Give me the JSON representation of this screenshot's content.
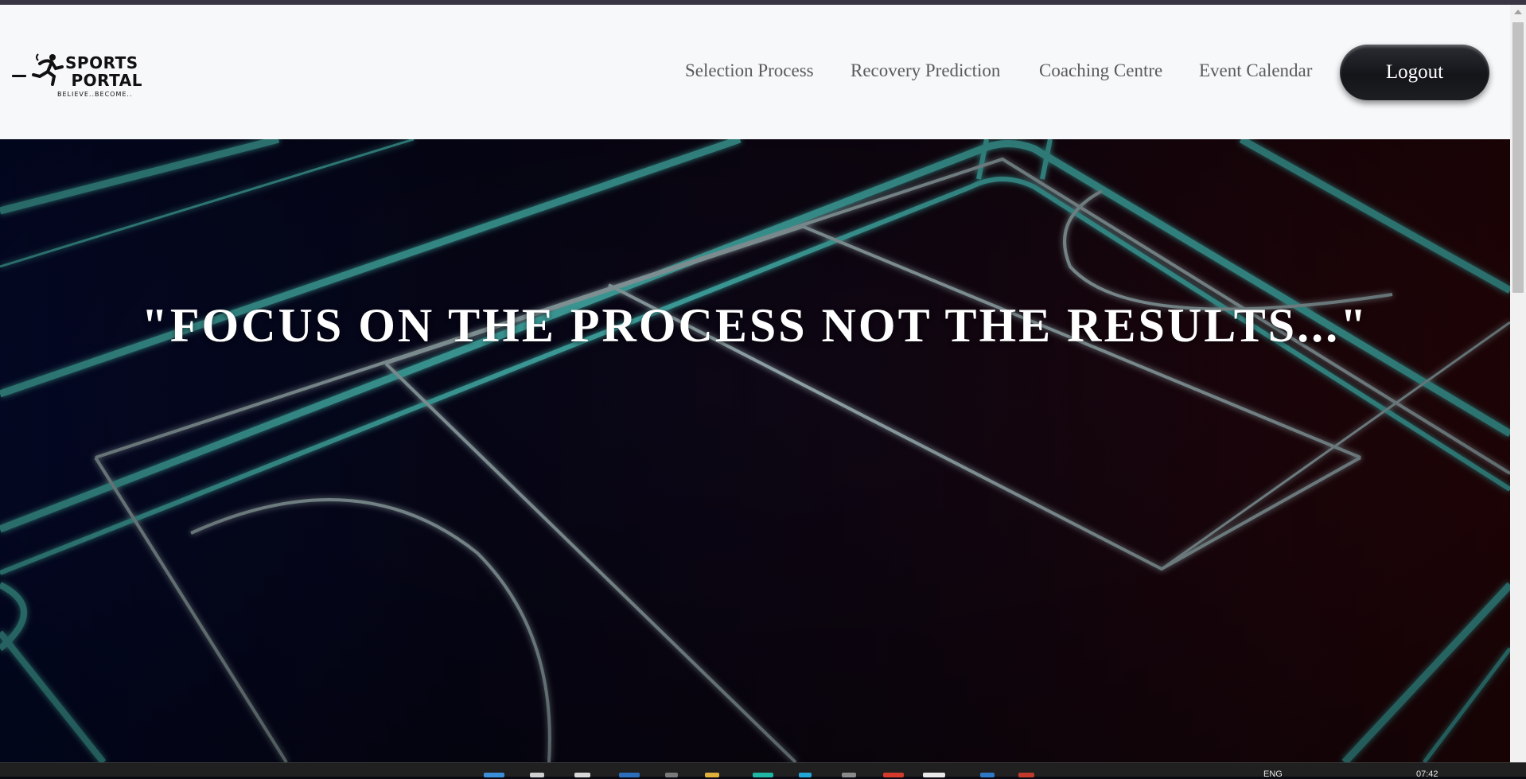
{
  "brand": {
    "title": "SPORTS\n PORTAL",
    "tagline": "BELIEVE..BECOME.."
  },
  "nav": {
    "links": [
      {
        "label": "Selection Process"
      },
      {
        "label": "Recovery Prediction"
      },
      {
        "label": "Coaching Centre"
      },
      {
        "label": "Event Calendar"
      }
    ],
    "logout_label": "Logout"
  },
  "hero": {
    "quote": "\"FOCUS ON THE PROCESS NOT THE RESULTS...\""
  },
  "taskbar": {
    "language": "ENG",
    "clock": "07:42"
  },
  "colors": {
    "court_line": "#3fa7a3",
    "nav_bg": "#f7f8fa",
    "logout_bg": "#16171b"
  },
  "icons": [
    "menu-toggle-icon",
    "runner-logo-icon",
    "scroll-up-icon"
  ]
}
